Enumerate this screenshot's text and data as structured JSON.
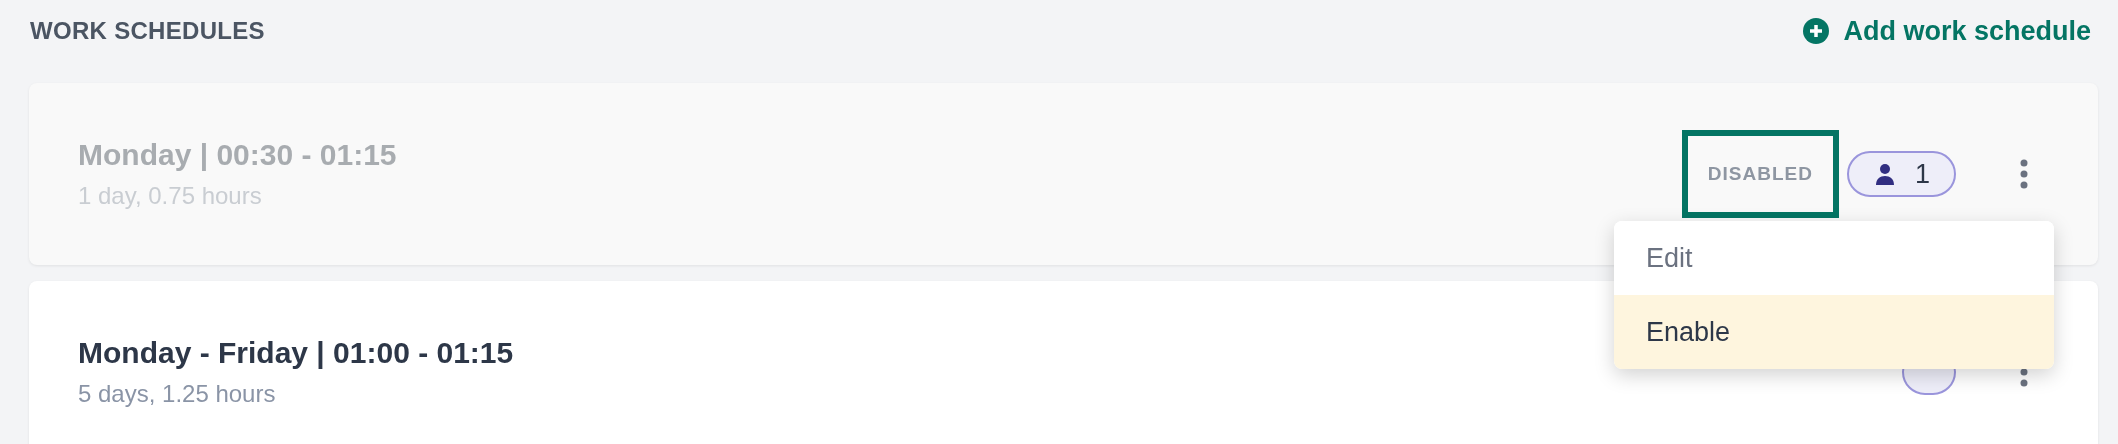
{
  "header": {
    "title": "WORK SCHEDULES",
    "add_link": "Add work schedule"
  },
  "schedules": [
    {
      "title": "Monday | 00:30 - 01:15",
      "summary": "1 day, 0.75 hours",
      "disabled": true,
      "status": "DISABLED",
      "status_focused": true,
      "count": "1"
    },
    {
      "title": "Monday - Friday | 01:00 - 01:15",
      "summary": "5 days, 1.25 hours",
      "disabled": false
    }
  ],
  "menu": {
    "items": [
      {
        "label": "Edit",
        "selected": false
      },
      {
        "label": "Enable",
        "selected": true
      }
    ]
  }
}
